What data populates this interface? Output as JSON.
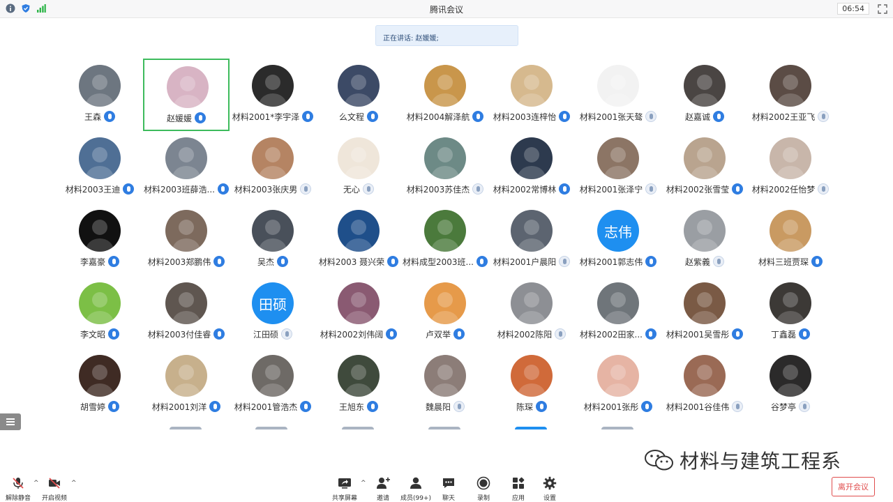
{
  "window": {
    "title": "腾讯会议",
    "time": "06:54"
  },
  "speaker_banner": "正在讲话: 赵媛媛;",
  "participants": [
    {
      "name": "王森",
      "mic": "on",
      "color": "#6d7680"
    },
    {
      "name": "赵媛媛",
      "mic": "on",
      "color": "#d8b4c4",
      "active": true
    },
    {
      "name": "材料2001*李宇泽",
      "mic": "on",
      "color": "#2b2b2b"
    },
    {
      "name": "么文程",
      "mic": "on",
      "color": "#3c4a66"
    },
    {
      "name": "材料2004解泽航",
      "mic": "on",
      "color": "#c9964b"
    },
    {
      "name": "材料2003连梓怡",
      "mic": "on",
      "color": "#d6b98e"
    },
    {
      "name": "材料2001张天骜",
      "mic": "off",
      "color": "#f2f2f2"
    },
    {
      "name": "赵嘉诚",
      "mic": "on",
      "color": "#4a4543"
    },
    {
      "name": "材料2002王亚飞",
      "mic": "off",
      "color": "#5b4c45"
    },
    {
      "name": "材料2003王迪",
      "mic": "on",
      "color": "#4f6f95"
    },
    {
      "name": "材料2003班薛浩...",
      "mic": "on",
      "color": "#7c8591"
    },
    {
      "name": "材料2003张庆男",
      "mic": "off",
      "color": "#b58463"
    },
    {
      "name": "无心",
      "mic": "off",
      "color": "#efe6da"
    },
    {
      "name": "材料2003苏佳杰",
      "mic": "off",
      "color": "#6d8a86"
    },
    {
      "name": "材料2002常博林",
      "mic": "on",
      "color": "#2d3a4e"
    },
    {
      "name": "材料2001张泽宁",
      "mic": "off",
      "color": "#8c7565"
    },
    {
      "name": "材料2002张雪莹",
      "mic": "on",
      "color": "#b9a48f"
    },
    {
      "name": "材料2002任怡梦",
      "mic": "off",
      "color": "#c8b6aa"
    },
    {
      "name": "李嘉豪",
      "mic": "on",
      "color": "#111111"
    },
    {
      "name": "材料2003郑鹏伟",
      "mic": "on",
      "color": "#7d6a5d"
    },
    {
      "name": "吴杰",
      "mic": "on",
      "color": "#49505a"
    },
    {
      "name": "材料2003  聂兴荣",
      "mic": "on",
      "color": "#1f4f8a"
    },
    {
      "name": "材料成型2003班...",
      "mic": "on",
      "color": "#4b7a3c"
    },
    {
      "name": "材料2001户晨阳",
      "mic": "off",
      "color": "#5c6470"
    },
    {
      "name": "材料2001郭志伟",
      "mic": "on",
      "color": "#1e8ff0",
      "text": "志伟"
    },
    {
      "name": "赵紫義",
      "mic": "off",
      "color": "#9a9ea3"
    },
    {
      "name": "材料三班贾琛",
      "mic": "on",
      "color": "#c99a62"
    },
    {
      "name": "李文昭",
      "mic": "on",
      "color": "#7cbf46"
    },
    {
      "name": "材料2003付佳睿",
      "mic": "on",
      "color": "#5f5650"
    },
    {
      "name": "江田硕",
      "mic": "off",
      "color": "#1e8ff0",
      "text": "田硕"
    },
    {
      "name": "材料2002刘伟阔",
      "mic": "on",
      "color": "#8a5a72"
    },
    {
      "name": "卢双举",
      "mic": "on",
      "color": "#e69a4a"
    },
    {
      "name": "材料2002陈阳",
      "mic": "off",
      "color": "#8d8f94"
    },
    {
      "name": "材料2002田家...",
      "mic": "on",
      "color": "#6f757a"
    },
    {
      "name": "材料2001吴雪彤",
      "mic": "on",
      "color": "#7a5a45"
    },
    {
      "name": "丁鑫磊",
      "mic": "on",
      "color": "#3c3936"
    },
    {
      "name": "胡雪婷",
      "mic": "on",
      "color": "#3f2b24"
    },
    {
      "name": "材料2001刘洋",
      "mic": "on",
      "color": "#c7b08c"
    },
    {
      "name": "材料2001管浩杰",
      "mic": "on",
      "color": "#6e6a66"
    },
    {
      "name": "王旭东",
      "mic": "on",
      "color": "#3f4a3c"
    },
    {
      "name": "魏晨阳",
      "mic": "off",
      "color": "#8c7d78"
    },
    {
      "name": "陈琛",
      "mic": "on",
      "color": "#d06a3a"
    },
    {
      "name": "材料2001张彤",
      "mic": "on",
      "color": "#e6b4a4"
    },
    {
      "name": "材料2001谷佳伟",
      "mic": "off",
      "color": "#9a6a55"
    },
    {
      "name": "谷梦亭",
      "mic": "off",
      "color": "#2b2a2a"
    }
  ],
  "toolbar": {
    "unmute": "解除静音",
    "start_video": "开启视频",
    "share": "共享屏幕",
    "invite": "邀请",
    "members": "成员(99+)",
    "chat": "聊天",
    "record": "录制",
    "apps": "应用",
    "settings": "设置",
    "leave": "离开会议"
  },
  "watermark": "材料与建筑工程系",
  "colors": {
    "accent": "#2f7de1",
    "active_border": "#3dbb5c",
    "leave": "#e04c4c"
  }
}
